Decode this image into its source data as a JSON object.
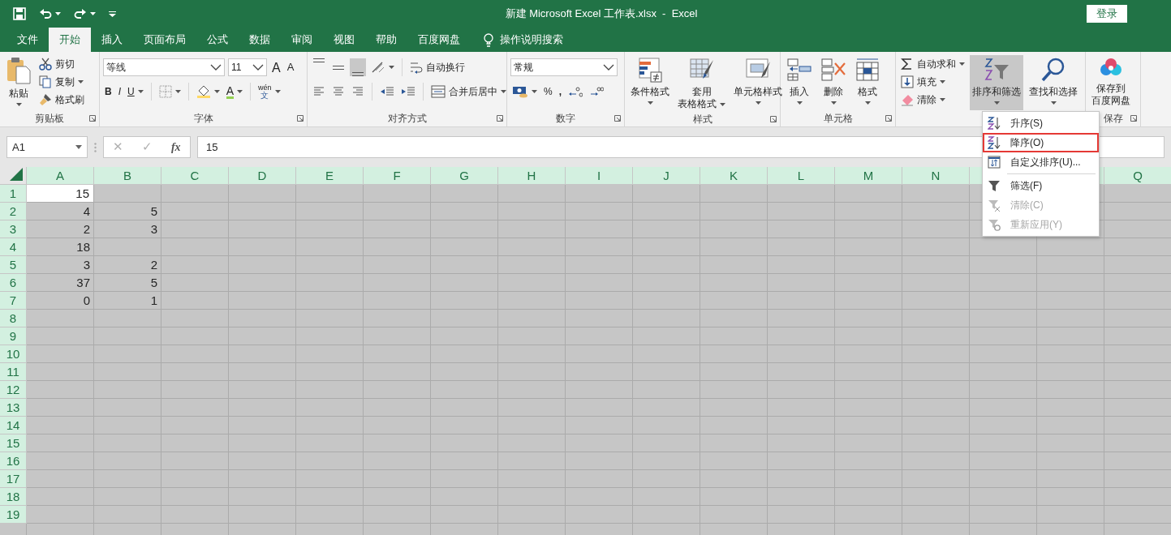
{
  "title_bar": {
    "title": "新建 Microsoft Excel 工作表.xlsx  -  Excel",
    "login": "登录"
  },
  "tabs": [
    {
      "label": "文件",
      "selected": false
    },
    {
      "label": "开始",
      "selected": true
    },
    {
      "label": "插入",
      "selected": false
    },
    {
      "label": "页面布局",
      "selected": false
    },
    {
      "label": "公式",
      "selected": false
    },
    {
      "label": "数据",
      "selected": false
    },
    {
      "label": "审阅",
      "selected": false
    },
    {
      "label": "视图",
      "selected": false
    },
    {
      "label": "帮助",
      "selected": false
    },
    {
      "label": "百度网盘",
      "selected": false
    }
  ],
  "tell_me": {
    "label": "操作说明搜索"
  },
  "ribbon": {
    "clipboard": {
      "label": "剪贴板",
      "paste": "粘贴",
      "cut": "剪切",
      "copy": "复制",
      "format_painter": "格式刷"
    },
    "font": {
      "label": "字体",
      "font_name": "等线",
      "font_size": "11",
      "grow": "A",
      "shrink": "A",
      "bold": "B",
      "italic": "I",
      "underline": "U",
      "font_color": "A",
      "phonetic_top": "wén",
      "phonetic_bottom": "文"
    },
    "alignment": {
      "label": "对齐方式",
      "wrap_text": "自动换行",
      "merge_center": "合并后居中",
      "vertical_align": [
        {
          "selected": false
        },
        {
          "selected": false
        },
        {
          "selected": true
        }
      ]
    },
    "number": {
      "label": "数字",
      "format": "常规",
      "percent": "%",
      "comma": ","
    },
    "styles": {
      "label": "样式",
      "conditional": "条件格式",
      "table_format_1": "套用",
      "table_format_2": "表格格式",
      "cell_styles": "单元格样式"
    },
    "cells": {
      "label": "单元格",
      "insert": "插入",
      "delete": "删除",
      "format": "格式"
    },
    "editing": {
      "autosum": "自动求和",
      "fill": "填充",
      "clear": "清除",
      "sort_filter": "排序和筛选",
      "sort_filter_pressed": true,
      "find_select": "查找和选择"
    },
    "save": {
      "label": "保存",
      "button_1": "保存到",
      "button_2": "百度网盘"
    }
  },
  "formula_bar": {
    "name_box": "A1",
    "cancel": "✕",
    "enter": "✓",
    "function": "fx",
    "value": "15"
  },
  "sheet": {
    "all_selected": true,
    "columns": [
      "A",
      "B",
      "C",
      "D",
      "E",
      "F",
      "G",
      "H",
      "I",
      "J",
      "K",
      "L",
      "M",
      "N",
      null,
      null,
      "Q"
    ],
    "rows": [
      {
        "label": "1",
        "cells": [
          {
            "value": "15",
            "active": true
          }
        ]
      },
      {
        "label": "2",
        "cells": [
          {
            "value": "4",
            "active": false
          },
          {
            "value": "5",
            "active": false
          }
        ]
      },
      {
        "label": "3",
        "cells": [
          {
            "value": "2",
            "active": false
          },
          {
            "value": "3",
            "active": false
          }
        ]
      },
      {
        "label": "4",
        "cells": [
          {
            "value": "18",
            "active": false
          }
        ]
      },
      {
        "label": "5",
        "cells": [
          {
            "value": "3",
            "active": false
          },
          {
            "value": "2",
            "active": false
          }
        ]
      },
      {
        "label": "6",
        "cells": [
          {
            "value": "37",
            "active": false
          },
          {
            "value": "5",
            "active": false
          }
        ]
      },
      {
        "label": "7",
        "cells": [
          {
            "value": "0",
            "active": false
          },
          {
            "value": "1",
            "active": false
          }
        ]
      },
      {
        "label": "8"
      },
      {
        "label": "9"
      },
      {
        "label": "10"
      },
      {
        "label": "11"
      },
      {
        "label": "12"
      },
      {
        "label": "13"
      },
      {
        "label": "14"
      },
      {
        "label": "15"
      },
      {
        "label": "16"
      },
      {
        "label": "17"
      },
      {
        "label": "18"
      },
      {
        "label": "19"
      }
    ]
  },
  "sort_menu": {
    "items": [
      {
        "kind": "ascending",
        "label": "升序(S)",
        "disabled": false,
        "highlighted": false
      },
      {
        "kind": "descending",
        "label": "降序(O)",
        "disabled": false,
        "highlighted": true
      },
      {
        "kind": "custom",
        "label": "自定义排序(U)...",
        "disabled": false,
        "highlighted": false
      },
      {
        "kind": "separator"
      },
      {
        "kind": "filter",
        "label": "筛选(F)",
        "disabled": false,
        "highlighted": false
      },
      {
        "kind": "clear",
        "label": "清除(C)",
        "disabled": true,
        "highlighted": false
      },
      {
        "kind": "reapply",
        "label": "重新应用(Y)",
        "disabled": true,
        "highlighted": false
      }
    ]
  }
}
